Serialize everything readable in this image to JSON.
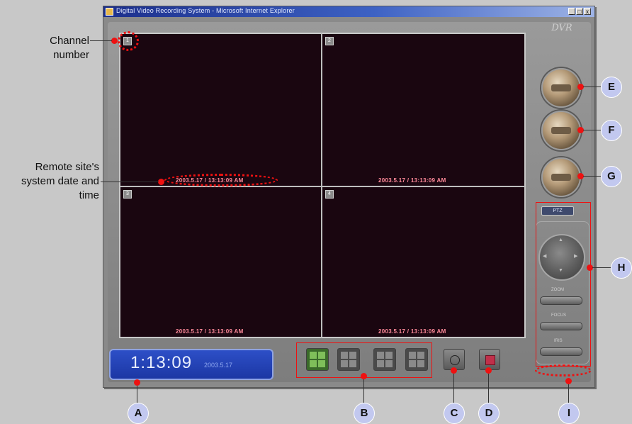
{
  "window": {
    "title": "Digital Video Recording System - Microsoft Internet Explorer",
    "controls": [
      "_",
      "□",
      "x"
    ]
  },
  "logo": "DVR",
  "channels": [
    {
      "number": "1",
      "osd": "2003.5.17 / 13:13:09 AM"
    },
    {
      "number": "2",
      "osd": "2003.5.17 / 13:13:09 AM"
    },
    {
      "number": "3",
      "osd": "2003.5.17 / 13:13:09 AM"
    },
    {
      "number": "4",
      "osd": "2003.5.17 / 13:13:09 AM"
    }
  ],
  "clock": {
    "time": "1:13:09",
    "date": "2003.5.17"
  },
  "ptz": {
    "label": "PTZ",
    "controls": [
      "ZOOM",
      "FOCUS",
      "IRIS"
    ]
  },
  "annotations": {
    "channel_number": "Channel number",
    "remote_datetime": "Remote site's system date and time",
    "labels": [
      "A",
      "B",
      "C",
      "D",
      "E",
      "F",
      "G",
      "H",
      "I"
    ]
  },
  "colors": {
    "annotation_red": "#ee1111",
    "label_circle": "#c2c8ef",
    "video_bg": "#1a0610",
    "osd_text": "#ff8a9a",
    "clock_bg": "#1c37a4"
  }
}
